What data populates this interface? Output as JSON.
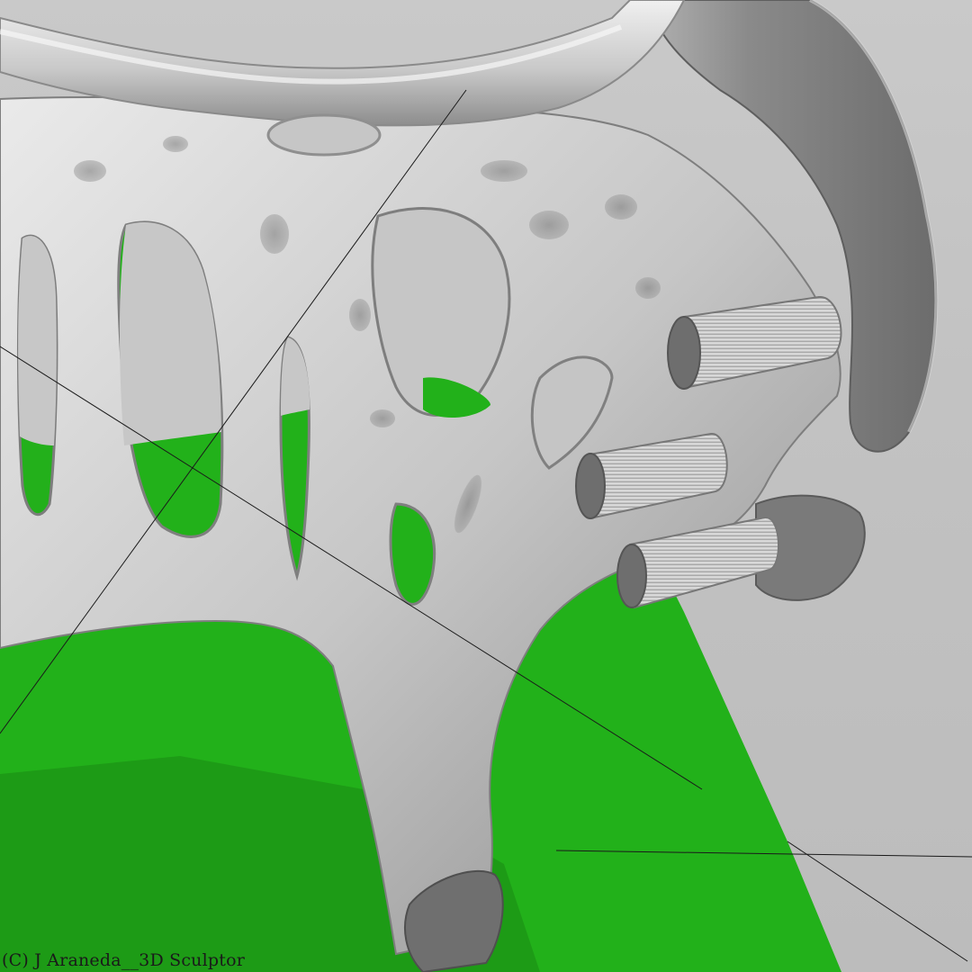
{
  "render": {
    "subject": "generative-lattice-sculpture",
    "colors": {
      "background": "#c4c4c4",
      "ground_plane": "#22b11a",
      "ground_plane_dark": "#1c9a15",
      "sculpture_light": "#e6e6e6",
      "sculpture_mid": "#b8b8b8",
      "sculpture_dark": "#6e6e6e",
      "guide_line": "#1a1a1a"
    }
  },
  "watermark": {
    "text": "(C) J Araneda__3D Sculptor"
  }
}
